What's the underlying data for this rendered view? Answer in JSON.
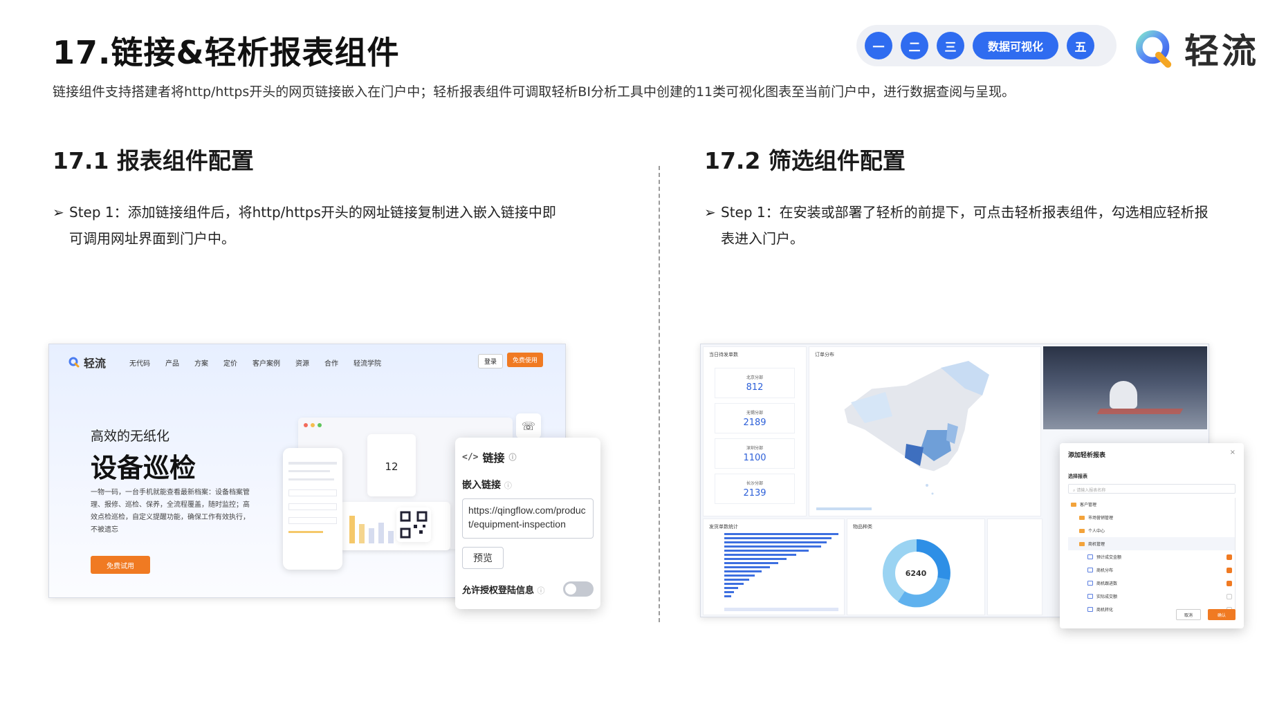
{
  "header": {
    "title": "17.链接&轻析报表组件",
    "subtitle": "链接组件支持搭建者将http/https开头的网页链接嵌入在门户中；轻析报表组件可调取轻析BI分析工具中创建的11类可视化图表至当前门户中，进行数据查阅与呈现。"
  },
  "nav": {
    "items": [
      "一",
      "二",
      "三",
      "数据可视化",
      "五"
    ],
    "active": "数据可视化",
    "color": "#2f6cf0"
  },
  "brand": {
    "name": "轻流"
  },
  "sections": {
    "left": {
      "heading": "17.1 报表组件配置",
      "step_line1": "Step 1：添加链接组件后，将http/https开头的网址链接复制进入嵌入链接中即",
      "step_line2": "可调用网址界面到门户中。"
    },
    "right": {
      "heading": "17.2 筛选组件配置",
      "step_line1": "Step 1：在安装或部署了轻析的前提下，可点击轻析报表组件，勾选相应轻析报",
      "step_line2": "表进入门户。"
    }
  },
  "left_shot": {
    "site_brand": "轻流",
    "nav_items": [
      "无代码",
      "产品",
      "方案",
      "定价",
      "客户案例",
      "资源",
      "合作",
      "轻流学院"
    ],
    "login": "登录",
    "trial": "免费使用",
    "hero_small": "高效的无纸化",
    "hero_big": "设备巡检",
    "hero_desc": "一物一码，一台手机就能查看最新档案：设备档案管理、报修、巡检、保养，全流程覆盖，随时监控；高效点检巡检，自定义提醒功能，确保工作有效执行，不被遗忘",
    "hero_btn": "免费试用",
    "count_value": "12",
    "link_panel": {
      "title": "链接",
      "embed_label": "嵌入链接",
      "url_value": "https://qingflow.com/product/equipment-inspection",
      "preview_btn": "预览",
      "auth_label": "允许授权登陆信息",
      "auth_enabled": false
    }
  },
  "right_shot": {
    "stats_title": "当日待发单数",
    "map_title": "订单分布",
    "stats": [
      {
        "name": "北京分部",
        "value": "812"
      },
      {
        "name": "无锡分部",
        "value": "2189"
      },
      {
        "name": "深圳分部",
        "value": "1100"
      },
      {
        "name": "长沙分部",
        "value": "2139"
      }
    ],
    "bar_panel_title": "发货单数统计",
    "donut_panel_title": "物品种类",
    "donut_value": "6240",
    "add_dialog": {
      "title": "添加轻析报表",
      "select_label": "选择报表",
      "search_placeholder": "请输入报表名称",
      "rows": [
        {
          "label": "客户管理",
          "type": "folder",
          "level": 0
        },
        {
          "label": "市场营销管理",
          "type": "folder",
          "level": 1
        },
        {
          "label": "个人中心",
          "type": "folder",
          "level": 1
        },
        {
          "label": "商机管理",
          "type": "folder",
          "level": 1
        },
        {
          "label": "预计成交金额",
          "type": "report",
          "level": 2,
          "checked": true
        },
        {
          "label": "商机分布",
          "type": "report",
          "level": 2,
          "checked": true
        },
        {
          "label": "商机跟进数",
          "type": "report",
          "level": 2,
          "checked": true
        },
        {
          "label": "实际成交额",
          "type": "report",
          "level": 2,
          "checked": false
        },
        {
          "label": "商机转化",
          "type": "report",
          "level": 2,
          "checked": false
        }
      ],
      "cancel": "取消",
      "ok": "确认"
    }
  }
}
